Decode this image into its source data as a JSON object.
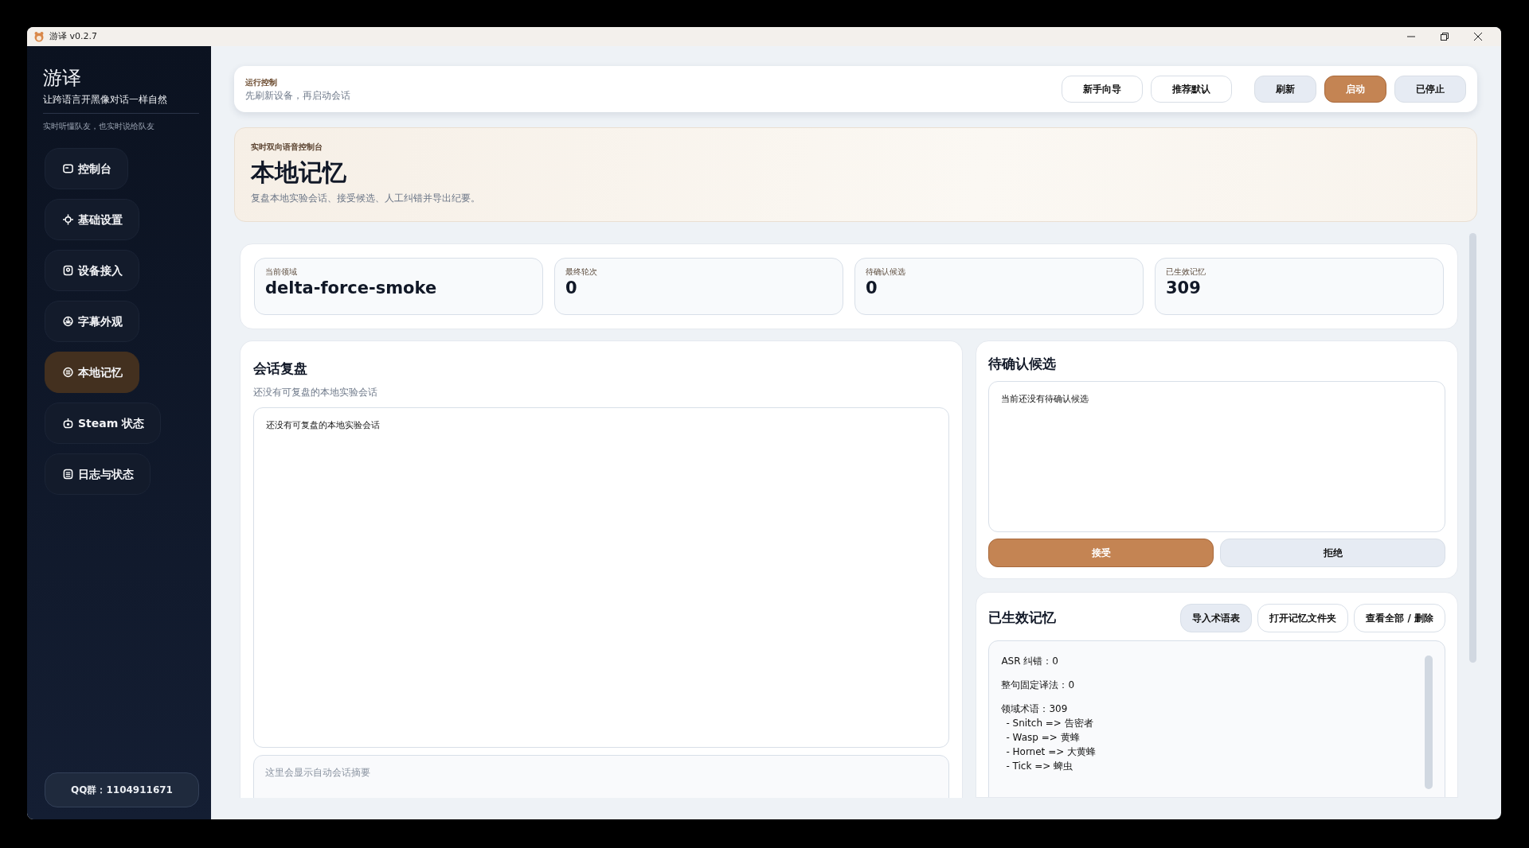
{
  "window": {
    "title": "游译 v0.2.7"
  },
  "sidebar": {
    "brand": "游译",
    "tagline": "让跨语言开黑像对话一样自然",
    "subtitle": "实时听懂队友，也实时说给队友",
    "items": [
      {
        "label": "控制台",
        "selected": false
      },
      {
        "label": "基础设置",
        "selected": false
      },
      {
        "label": "设备接入",
        "selected": false
      },
      {
        "label": "字幕外观",
        "selected": false
      },
      {
        "label": "本地记忆",
        "selected": true
      },
      {
        "label": "Steam 状态",
        "selected": false
      },
      {
        "label": "日志与状态",
        "selected": false
      }
    ],
    "footer": "QQ群：1104911671"
  },
  "run_control": {
    "label": "运行控制",
    "hint": "先刷新设备，再启动会话",
    "buttons": [
      {
        "label": "新手向导",
        "kind": "outline"
      },
      {
        "label": "推荐默认",
        "kind": "outline"
      },
      {
        "label": "刷新",
        "kind": "soft"
      },
      {
        "label": "启动",
        "kind": "primary"
      },
      {
        "label": "已停止",
        "kind": "soft"
      }
    ]
  },
  "hero": {
    "eyebrow": "实时双向语音控制台",
    "title": "本地记忆",
    "description": "复盘本地实验会话、接受候选、人工纠错并导出纪要。"
  },
  "stats": [
    {
      "label": "当前领域",
      "value": "delta-force-smoke"
    },
    {
      "label": "最终轮次",
      "value": "0"
    },
    {
      "label": "待确认候选",
      "value": "0"
    },
    {
      "label": "已生效记忆",
      "value": "309"
    }
  ],
  "session_review": {
    "title": "会话复盘",
    "subtitle": "还没有可复盘的本地实验会话",
    "list_text": "还没有可复盘的本地实验会话",
    "summary": {
      "placeholder": "这里会显示自动会话摘要"
    }
  },
  "pending": {
    "title": "待确认候选",
    "box_text": "当前还没有待确认候选",
    "buttons": [
      {
        "label": "接受",
        "kind": "primary"
      },
      {
        "label": "拒绝",
        "kind": "soft"
      }
    ]
  },
  "active_memory": {
    "title": "已生效记忆",
    "buttons": [
      {
        "label": "导入术语表",
        "kind": "soft"
      },
      {
        "label": "打开记忆文件夹",
        "kind": "outline"
      },
      {
        "label": "查看全部 / 删除",
        "kind": "outline"
      }
    ],
    "sections": [
      {
        "heading": "ASR 纠错：0"
      },
      {
        "heading": "整句固定译法：0"
      },
      {
        "heading": "领域术语：309",
        "items": [
          "- Snitch => 告密者",
          "- Wasp => 黄蜂",
          "- Hornet => 大黄蜂",
          "- Tick => 蜱虫"
        ]
      }
    ]
  }
}
